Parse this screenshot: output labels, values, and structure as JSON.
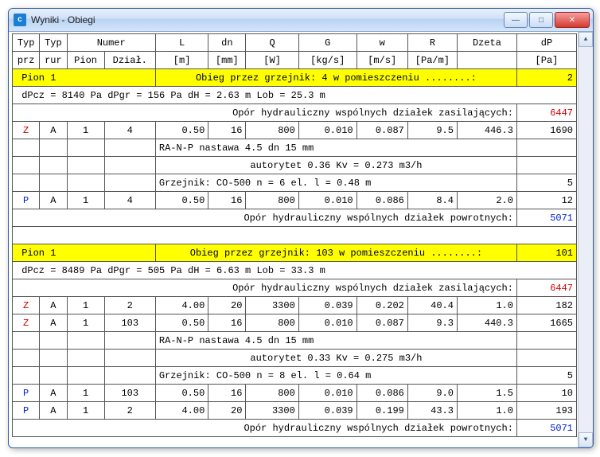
{
  "window": {
    "title": "Wyniki - Obiegi"
  },
  "headers": {
    "row1": [
      "Typ",
      "Typ",
      "Numer",
      "L",
      "dn",
      "Q",
      "G",
      "w",
      "R",
      "Dzeta",
      "dP"
    ],
    "row2": [
      "prz",
      "rur",
      "Pion",
      "Dział.",
      "[m]",
      "[mm]",
      "[W]",
      "[kg/s]",
      "[m/s]",
      "[Pa/m]",
      "",
      "[Pa]"
    ]
  },
  "circuits": [
    {
      "pion": "Pion 1",
      "obieg_text": "Obieg przez  grzejnik: 4     w pomieszczeniu ........:",
      "obieg_num": "2",
      "summary": "dPcz =     8140 Pa      dPgr =    156 Pa      dH =  2.63 m        Lob =  25.3 m",
      "opor_zasil": "Opór hydrauliczny wspólnych działek zasilających:",
      "opor_zasil_val": "6447",
      "rows_supply": [
        {
          "t1": "Z",
          "t2": "A",
          "pion": "1",
          "dz": "4",
          "L": "0.50",
          "dn": "16",
          "Q": "800",
          "G": "0.010",
          "w": "0.087",
          "R": "9.5",
          "Dz": "446.3",
          "dP": "1690"
        }
      ],
      "valve1": "RA-N-P        nastawa  4.5        dn  15 mm",
      "valve2": "autorytet  0.36    Kv =  0.273 m3/h",
      "radiator": "Grzejnik: CO-500         n =   6 el.   l =  0.48 m",
      "radiator_dP": "5",
      "rows_return": [
        {
          "t1": "P",
          "t2": "A",
          "pion": "1",
          "dz": "4",
          "L": "0.50",
          "dn": "16",
          "Q": "800",
          "G": "0.010",
          "w": "0.086",
          "R": "8.4",
          "Dz": "2.0",
          "dP": "12"
        }
      ],
      "opor_powr": "Opór hydrauliczny wspólnych działek powrotnych:",
      "opor_powr_val": "5071"
    },
    {
      "pion": "Pion 1",
      "obieg_text": "Obieg przez  grzejnik: 103   w pomieszczeniu ........:",
      "obieg_num": "101",
      "summary": "dPcz =     8489 Pa      dPgr =    505 Pa      dH =  6.63 m        Lob =  33.3 m",
      "opor_zasil": "Opór hydrauliczny wspólnych działek zasilających:",
      "opor_zasil_val": "6447",
      "rows_supply": [
        {
          "t1": "Z",
          "t2": "A",
          "pion": "1",
          "dz": "2",
          "L": "4.00",
          "dn": "20",
          "Q": "3300",
          "G": "0.039",
          "w": "0.202",
          "R": "40.4",
          "Dz": "1.0",
          "dP": "182"
        },
        {
          "t1": "Z",
          "t2": "A",
          "pion": "1",
          "dz": "103",
          "L": "0.50",
          "dn": "16",
          "Q": "800",
          "G": "0.010",
          "w": "0.087",
          "R": "9.3",
          "Dz": "440.3",
          "dP": "1665"
        }
      ],
      "valve1": "RA-N-P        nastawa  4.5        dn  15 mm",
      "valve2": "autorytet  0.33    Kv =  0.275 m3/h",
      "radiator": "Grzejnik: CO-500         n =   8 el.   l =  0.64 m",
      "radiator_dP": "5",
      "rows_return": [
        {
          "t1": "P",
          "t2": "A",
          "pion": "1",
          "dz": "103",
          "L": "0.50",
          "dn": "16",
          "Q": "800",
          "G": "0.010",
          "w": "0.086",
          "R": "9.0",
          "Dz": "1.5",
          "dP": "10"
        },
        {
          "t1": "P",
          "t2": "A",
          "pion": "1",
          "dz": "2",
          "L": "4.00",
          "dn": "20",
          "Q": "3300",
          "G": "0.039",
          "w": "0.199",
          "R": "43.3",
          "Dz": "1.0",
          "dP": "193"
        }
      ],
      "opor_powr": "Opór hydrauliczny wspólnych działek powrotnych:",
      "opor_powr_val": "5071"
    }
  ]
}
